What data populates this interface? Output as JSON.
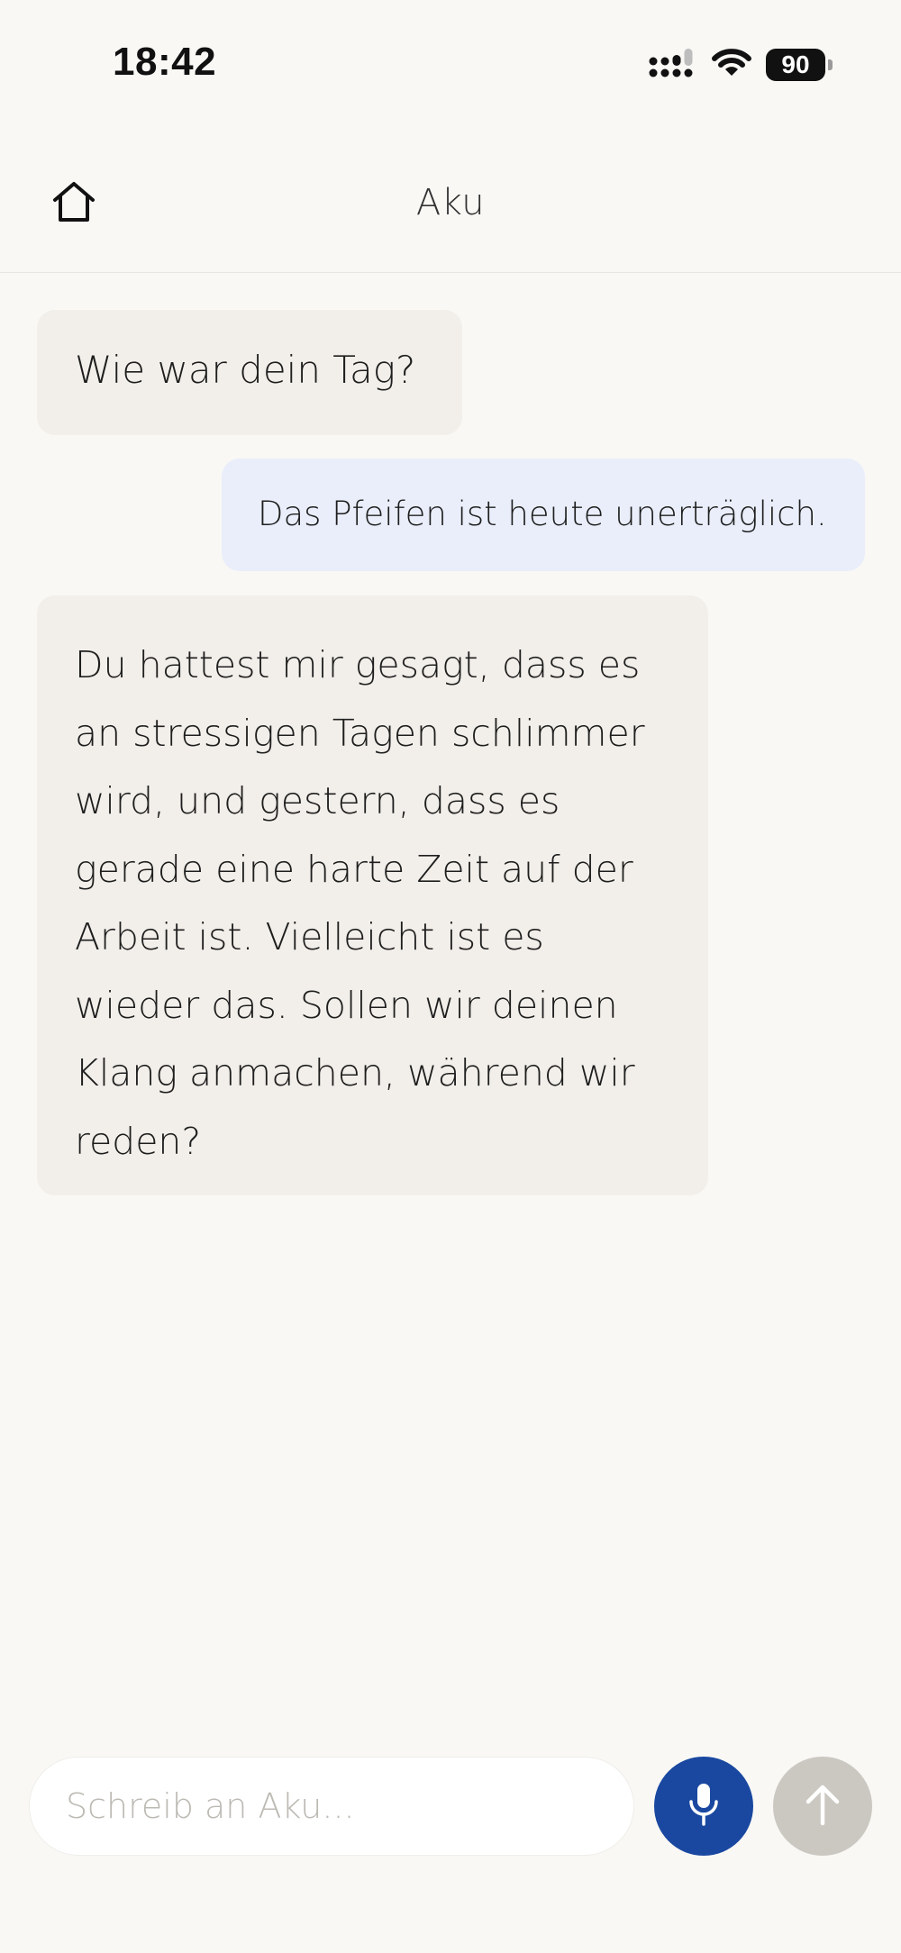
{
  "status_bar": {
    "time": "18:42",
    "battery": "90",
    "icons": [
      "cellular-signal-icon",
      "wifi-icon",
      "battery-icon"
    ]
  },
  "header": {
    "title": "Aku",
    "home_icon": "home-icon"
  },
  "messages": [
    {
      "role": "assistant",
      "text": "Wie war dein Tag?"
    },
    {
      "role": "user",
      "text": "Das Pfeifen ist heute unerträglich."
    },
    {
      "role": "assistant",
      "text": "Du hattest mir gesagt, dass es an stressigen Tagen schlimmer wird, und gestern, dass es gerade eine harte Zeit auf der Arbeit ist. Vielleicht ist es wieder das. Sollen wir deinen Klang anmachen, während wir reden?"
    }
  ],
  "composer": {
    "value": "",
    "placeholder": "Schreib an Aku...",
    "mic_icon": "microphone-icon",
    "send_icon": "arrow-up-icon"
  },
  "colors": {
    "background": "#f9f8f5",
    "assistant_bubble": "#f2efea",
    "user_bubble": "#e9eefa",
    "accent": "#1a48a0",
    "send_disabled": "#cbc8c2"
  }
}
